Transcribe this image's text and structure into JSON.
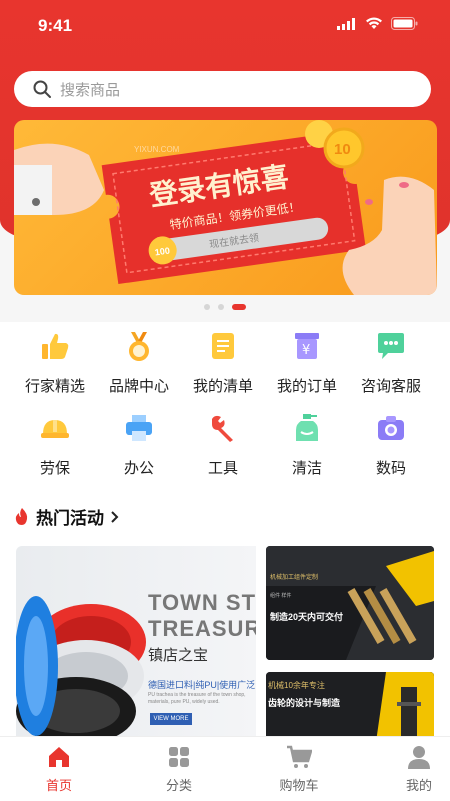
{
  "status": {
    "time": "9:41"
  },
  "search": {
    "placeholder": "搜索商品"
  },
  "banner": {
    "site": "YIXUN.COM",
    "headline": "登录有惊喜",
    "subline": "特价商品！领券价更低！",
    "coupon_value": "100",
    "cta": "现在就去领",
    "coin_value": "10"
  },
  "carousel": {
    "count": 3,
    "active_index": 2
  },
  "grid": {
    "row1": [
      {
        "label": "行家精选",
        "icon": "thumbs-up-icon"
      },
      {
        "label": "品牌中心",
        "icon": "medal-icon"
      },
      {
        "label": "我的清单",
        "icon": "list-icon"
      },
      {
        "label": "我的订单",
        "icon": "yuan-order-icon"
      },
      {
        "label": "咨询客服",
        "icon": "chat-icon"
      }
    ],
    "row2": [
      {
        "label": "劳保",
        "icon": "helmet-icon"
      },
      {
        "label": "办公",
        "icon": "printer-icon"
      },
      {
        "label": "工具",
        "icon": "wrench-icon"
      },
      {
        "label": "清洁",
        "icon": "spray-bottle-icon"
      },
      {
        "label": "数码",
        "icon": "camera-icon"
      }
    ]
  },
  "hot": {
    "title": "热门活动",
    "big_card": {
      "headline_en_1": "TOWN ST",
      "headline_en_2": "TREASUR",
      "headline_cn": "镇店之宝",
      "tagline": "德国进口料|纯PU|使用广泛",
      "desc_1": "PU trachea is the treasure of the town shop,",
      "desc_2": "materials, pure PU, widely used.",
      "button": "VIEW MORE"
    },
    "card2": {
      "line1": "机械加工组件定制",
      "line2": "组件 样件",
      "line3": "制造20天内可交付"
    },
    "card3": {
      "line1": "机械10余年专注",
      "line2": "齿轮的设计与制造"
    }
  },
  "tabs": [
    {
      "label": "首页",
      "icon": "home-icon"
    },
    {
      "label": "分类",
      "icon": "category-icon"
    },
    {
      "label": "购物车",
      "icon": "cart-icon"
    },
    {
      "label": "我的",
      "icon": "user-icon"
    }
  ],
  "colors": {
    "brand_red": "#e8352e",
    "banner_orange": "#f99a1c"
  }
}
